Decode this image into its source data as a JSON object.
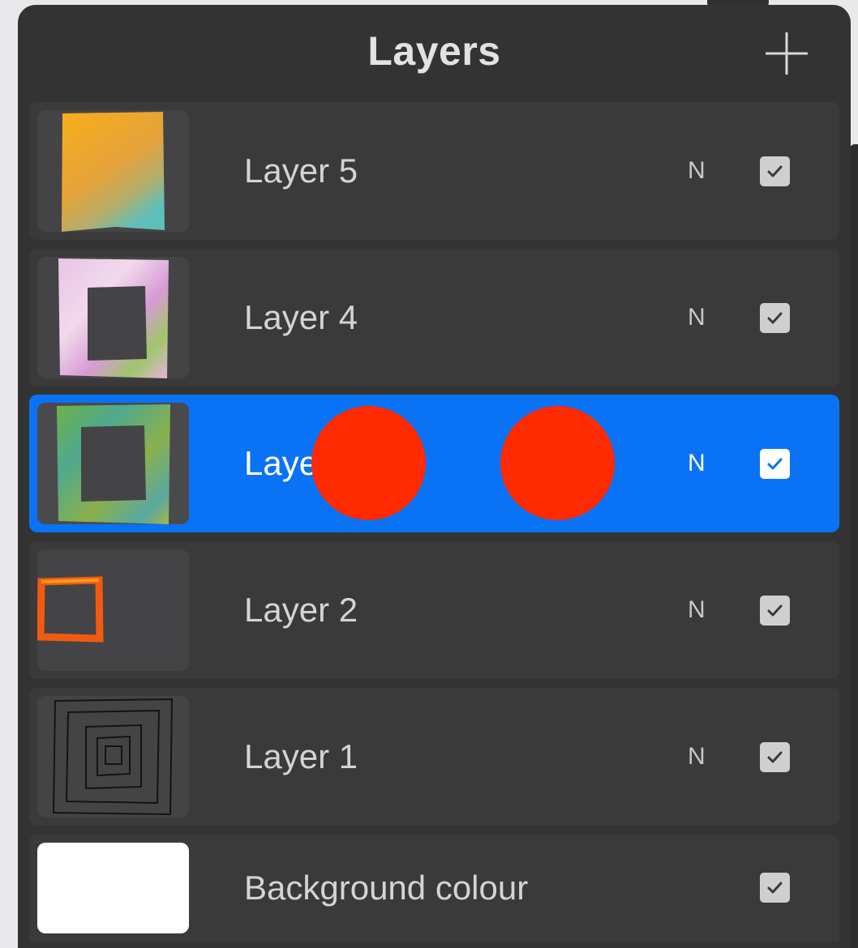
{
  "panel": {
    "title": "Layers",
    "add_button_icon": "plus-icon"
  },
  "layers": [
    {
      "name": "Layer 5",
      "blend_mode": "N",
      "visible": true,
      "selected": false,
      "thumbnail": "yellow-orange-gradient-rectangle"
    },
    {
      "name": "Layer 4",
      "blend_mode": "N",
      "visible": true,
      "selected": false,
      "thumbnail": "pink-green-square-frame"
    },
    {
      "name": "Layer 3",
      "blend_mode": "N",
      "visible": true,
      "selected": true,
      "thumbnail": "green-teal-square-frame"
    },
    {
      "name": "Layer 2",
      "blend_mode": "N",
      "visible": true,
      "selected": false,
      "thumbnail": "small-orange-square-outline"
    },
    {
      "name": "Layer 1",
      "blend_mode": "N",
      "visible": true,
      "selected": false,
      "thumbnail": "black-concentric-squares-sketch"
    }
  ],
  "background": {
    "name": "Background colour",
    "visible": true,
    "color": "#ffffff"
  },
  "colors": {
    "panel": "#333334",
    "row": "#3a3a3b",
    "selected_row": "#0a72f5",
    "touch_indicator": "#ff2a00"
  }
}
